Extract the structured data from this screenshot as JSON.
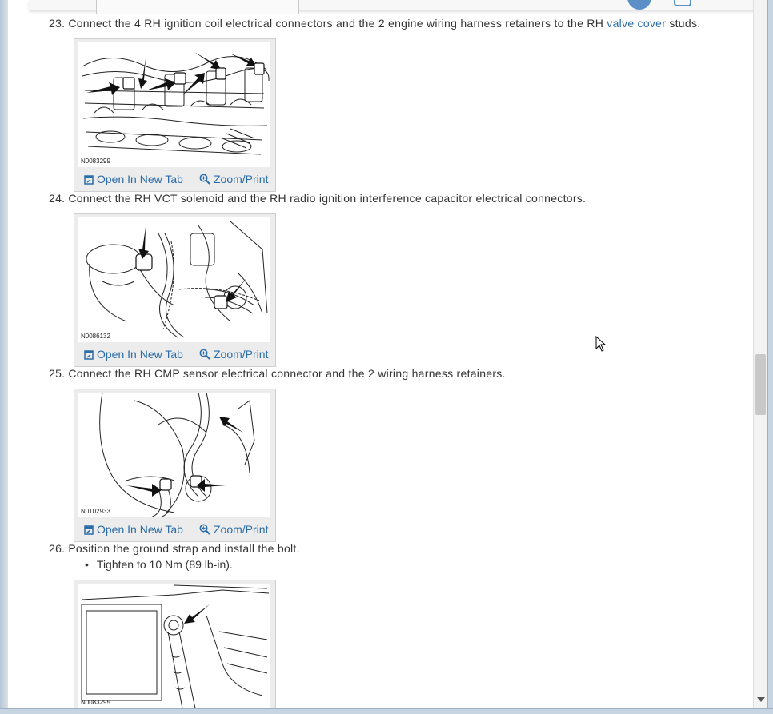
{
  "steps": [
    {
      "number": "23.",
      "text_before": "Connect the 4 RH ignition coil electrical connectors and the 2 engine wiring harness retainers to the RH ",
      "link_text": "valve cover",
      "text_after": " studs.",
      "figure_code": "N0083299"
    },
    {
      "number": "24.",
      "text": "Connect the RH VCT solenoid and the RH radio ignition interference capacitor electrical connectors.",
      "figure_code": "N0086132"
    },
    {
      "number": "25.",
      "text": "Connect the RH CMP sensor electrical connector and the 2 wiring harness retainers.",
      "figure_code": "N0102933"
    },
    {
      "number": "26.",
      "text": "Position the ground strap and install the bolt.",
      "bullet": "Tighten to 10 Nm (89 lb-in).",
      "figure_code": "N0083295"
    }
  ],
  "figure_actions": {
    "open_label": "Open In New Tab",
    "zoom_label": "Zoom/Print"
  },
  "colors": {
    "link": "#2b6da8",
    "text": "#333333"
  },
  "icons": [
    "open-in-new-tab-icon",
    "zoom-icon",
    "mouse-cursor-icon"
  ]
}
